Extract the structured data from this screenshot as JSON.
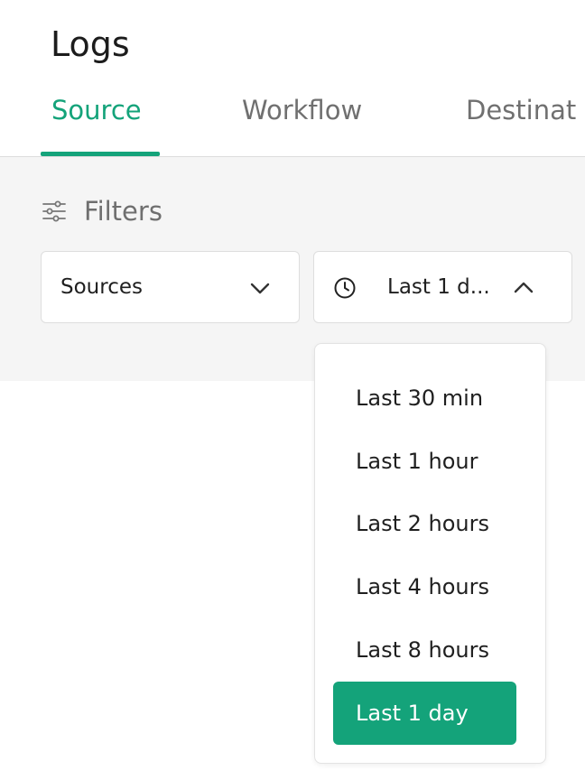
{
  "page": {
    "title": "Logs"
  },
  "tabs": [
    {
      "label": "Source",
      "active": true
    },
    {
      "label": "Workflow",
      "active": false
    },
    {
      "label": "Destinat",
      "active": false
    }
  ],
  "filters": {
    "label": "Filters",
    "icon": "sliders-icon",
    "sources_select": {
      "value": "Sources",
      "icon": "chevron-down-icon"
    },
    "time_select": {
      "value": "Last 1 d...",
      "icon": "clock-icon",
      "chevron": "chevron-up-icon"
    }
  },
  "time_dropdown": {
    "options": [
      {
        "label": "Last 30 min",
        "selected": false
      },
      {
        "label": "Last 1 hour",
        "selected": false
      },
      {
        "label": "Last 2 hours",
        "selected": false
      },
      {
        "label": "Last 4 hours",
        "selected": false
      },
      {
        "label": "Last 8 hours",
        "selected": false
      },
      {
        "label": "Last 1 day",
        "selected": true
      }
    ]
  },
  "colors": {
    "accent": "#14a37a",
    "panel_bg": "#f5f5f5",
    "muted_text": "#707070"
  }
}
